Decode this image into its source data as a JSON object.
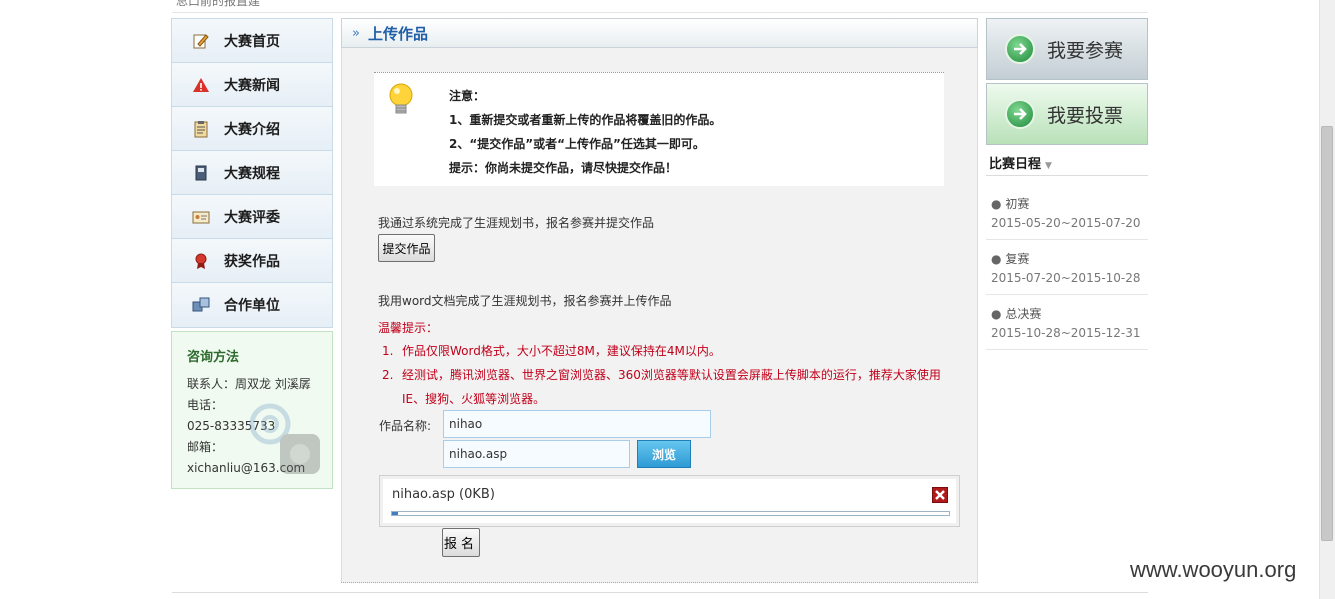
{
  "top": {
    "cut_text": "总口前的报置建"
  },
  "nav": {
    "items": [
      {
        "label": "大赛首页",
        "icon": "edit-icon"
      },
      {
        "label": "大赛新闻",
        "icon": "warning-icon"
      },
      {
        "label": "大赛介绍",
        "icon": "clipboard-icon"
      },
      {
        "label": "大赛规程",
        "icon": "book-icon"
      },
      {
        "label": "大赛评委",
        "icon": "id-card-icon"
      },
      {
        "label": "获奖作品",
        "icon": "award-icon"
      },
      {
        "label": "合作单位",
        "icon": "partners-icon"
      }
    ]
  },
  "consult": {
    "title": "咨询方法",
    "lines": [
      "联系人：周双龙 刘溪孱",
      "电话：",
      "025-83335733",
      "邮箱：",
      "xichanliu@163.com"
    ]
  },
  "main": {
    "title": "上传作品",
    "notice": {
      "lines": [
        "注意：",
        "1、重新提交或者重新上传的作品将覆盖旧的作品。",
        "2、“提交作品”或者“上传作品”任选其一即可。",
        "提示：你尚未提交作品，请尽快提交作品！"
      ]
    },
    "section1_text": "我通过系统完成了生涯规划书，报名参赛并提交作品",
    "submit_label": "提交作品",
    "section2_text": "我用word文档完成了生涯规划书，报名参赛并上传作品",
    "tip_title": "温馨提示：",
    "tips": [
      {
        "num": "1.",
        "text": "作品仅限Word格式，大小不超过8M，建议保持在4M以内。"
      },
      {
        "num": "2.",
        "text": "经测试，腾讯浏览器、世界之窗浏览器、360浏览器等默认设置会屏蔽上传脚本的运行，推荐大家使用IE、搜狗、火狐等浏览器。"
      }
    ],
    "name_label": "作品名称:",
    "name_value": "nihao",
    "file_value": "nihao.asp",
    "browse_label": "浏览",
    "upload": {
      "filename": "nihao.asp (0KB)",
      "progress": 0.01
    },
    "signup_label": "报名"
  },
  "right": {
    "join_label": "我要参赛",
    "vote_label": "我要投票",
    "schedule_title": "比赛日程",
    "schedule": [
      {
        "name": "初赛",
        "date": "2015-05-20~2015-07-20"
      },
      {
        "name": "复赛",
        "date": "2015-07-20~2015-10-28"
      },
      {
        "name": "总决赛",
        "date": "2015-10-28~2015-12-31"
      }
    ]
  },
  "watermark": "www.wooyun.org"
}
